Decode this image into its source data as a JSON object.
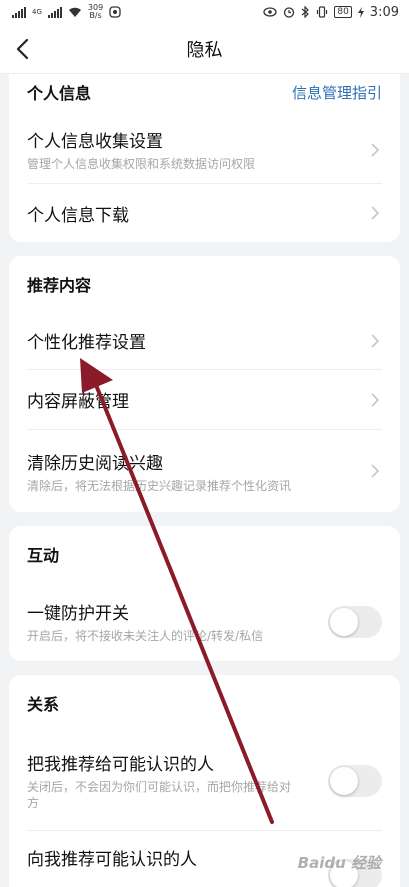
{
  "status_bar": {
    "left_network": "4G",
    "speed_value": "309",
    "speed_unit": "B/s",
    "battery": "80",
    "time": "3:09"
  },
  "header": {
    "title": "隐私"
  },
  "sections": {
    "personal": {
      "title": "个人信息",
      "link": "信息管理指引",
      "items": [
        {
          "title": "个人信息收集设置",
          "sub": "管理个人信息收集权限和系统数据访问权限"
        },
        {
          "title": "个人信息下载"
        }
      ]
    },
    "recommend": {
      "title": "推荐内容",
      "items": [
        {
          "title": "个性化推荐设置"
        },
        {
          "title": "内容屏蔽管理"
        },
        {
          "title": "清除历史阅读兴趣",
          "sub": "清除后，将无法根据历史兴趣记录推荐个性化资讯"
        }
      ]
    },
    "interaction": {
      "title": "互动",
      "items": [
        {
          "title": "一键防护开关",
          "sub": "开启后，将不接收未关注人的评论/转发/私信",
          "toggle": "off"
        }
      ]
    },
    "relation": {
      "title": "关系",
      "items": [
        {
          "title": "把我推荐给可能认识的人",
          "sub": "关闭后，不会因为你们可能认识，而把你推荐给对方",
          "toggle": "off"
        },
        {
          "title": "向我推荐可能认识的人",
          "toggle": "off"
        }
      ]
    }
  },
  "watermark": "Baidu 经验",
  "colors": {
    "accent_link": "#2f6fb5",
    "annotation_arrow": "#8b1a2b"
  }
}
